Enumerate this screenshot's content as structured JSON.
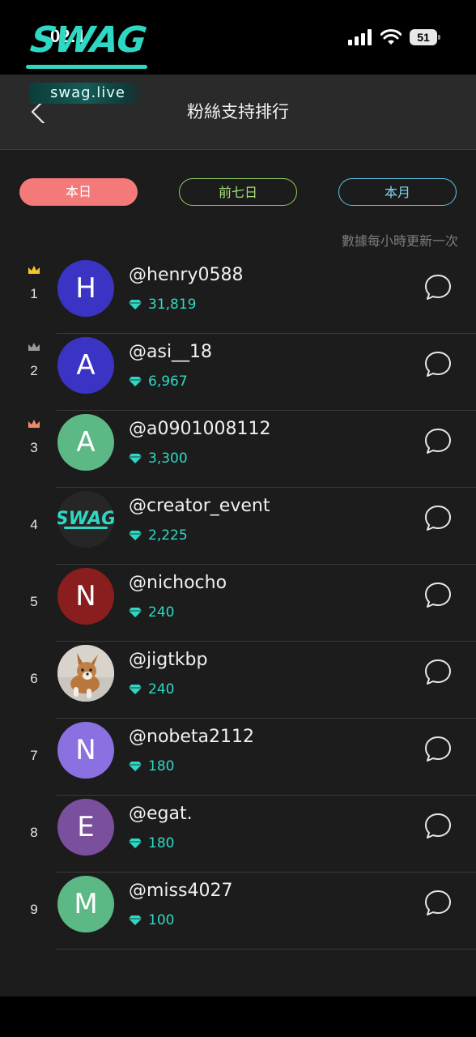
{
  "status_bar": {
    "time": "02:1",
    "battery": "51",
    "icons": [
      "signal-icon",
      "wifi-icon",
      "battery-icon"
    ]
  },
  "logo": {
    "word": "SWAG",
    "site": "swag.live"
  },
  "header": {
    "title": "粉絲支持排行",
    "back_icon": "chevron-left-icon"
  },
  "tabs": [
    {
      "label": "本日",
      "active": true,
      "color": "#f47a7a"
    },
    {
      "label": "前七日",
      "active": false,
      "color": "#8fcf5f"
    },
    {
      "label": "本月",
      "active": false,
      "color": "#5ec6e8"
    }
  ],
  "note": "數據每小時更新一次",
  "colors": {
    "accent": "#2ed8c3",
    "background": "#1c1c1c",
    "header": "#2a2a2a",
    "crown_gold": "#f4c430",
    "crown_silver": "#9a9a9a",
    "crown_bronze": "#f08a6a"
  },
  "ranking": [
    {
      "rank": "1",
      "initial": "H",
      "avatar_color": "#3b33c4",
      "name": "@henry0588",
      "score": "31,819",
      "crown": "gold"
    },
    {
      "rank": "2",
      "initial": "A",
      "avatar_color": "#3b33c4",
      "name": "@asi__18",
      "score": "6,967",
      "crown": "silver"
    },
    {
      "rank": "3",
      "initial": "A",
      "avatar_color": "#5cb885",
      "name": "@a0901008112",
      "score": "3,300",
      "crown": "bronze"
    },
    {
      "rank": "4",
      "initial": "",
      "avatar_color": "#262626",
      "name": "@creator_event",
      "score": "2,225",
      "crown": "",
      "avatar_image": "swag-logo"
    },
    {
      "rank": "5",
      "initial": "N",
      "avatar_color": "#8a1e1e",
      "name": "@nichocho",
      "score": "240",
      "crown": ""
    },
    {
      "rank": "6",
      "initial": "",
      "avatar_color": "#cfcac2",
      "name": "@jigtkbp",
      "score": "240",
      "crown": "",
      "avatar_image": "dog-photo"
    },
    {
      "rank": "7",
      "initial": "N",
      "avatar_color": "#8a70e0",
      "name": "@nobeta2112",
      "score": "180",
      "crown": ""
    },
    {
      "rank": "8",
      "initial": "E",
      "avatar_color": "#7a4f9e",
      "name": "@egat.",
      "score": "180",
      "crown": ""
    },
    {
      "rank": "9",
      "initial": "M",
      "avatar_color": "#5cb885",
      "name": "@miss4027",
      "score": "100",
      "crown": ""
    }
  ]
}
